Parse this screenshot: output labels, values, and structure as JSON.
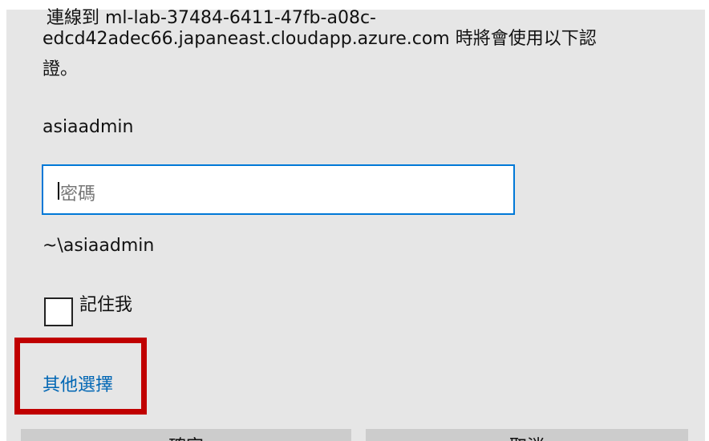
{
  "dialog": {
    "top_line_clipped": "連線到 ml-lab-37484-6411-47fb-a08c-",
    "message_line_1": "edcd42adec66.japaneast.cloudapp.azure.com 時將會使用以下認",
    "message_line_2": "證。",
    "username": "asiaadmin",
    "password_placeholder": "密碼",
    "domain_user": "~\\asiaadmin",
    "remember_me_label": "記住我",
    "more_choices_link": "其他選擇",
    "ok_button_label": "確定",
    "cancel_button_label": "取消"
  },
  "colors": {
    "dialog_background": "#e6e6e6",
    "input_border": "#0078d7",
    "link": "#0066b4",
    "highlight": "#c00000",
    "button_background": "#cccccc"
  },
  "icons": {
    "checkbox": "checkbox-unchecked-icon"
  }
}
